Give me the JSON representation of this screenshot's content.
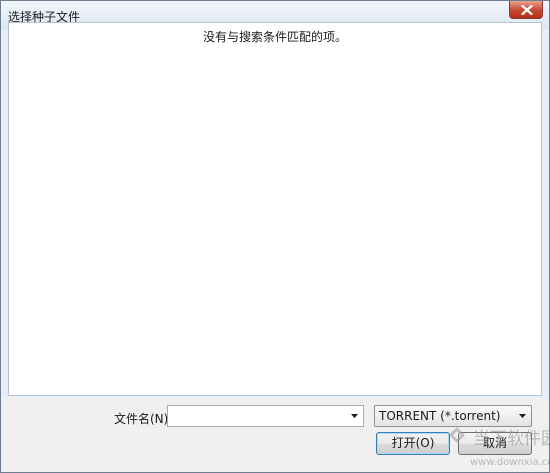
{
  "window": {
    "title": "选择种子文件"
  },
  "file_list": {
    "empty_message": "没有与搜索条件匹配的项。"
  },
  "file_name": {
    "label": "文件名(N):",
    "value": ""
  },
  "file_type": {
    "selected": "TORRENT (*.torrent)"
  },
  "buttons": {
    "open_label": "打开(O)",
    "cancel_label": "取消"
  },
  "watermark": {
    "site_name": "当下软件园",
    "site_url": "www.downxia.com"
  },
  "colors": {
    "close_button": "#c7462e",
    "default_button_border": "#3c7fb1"
  }
}
